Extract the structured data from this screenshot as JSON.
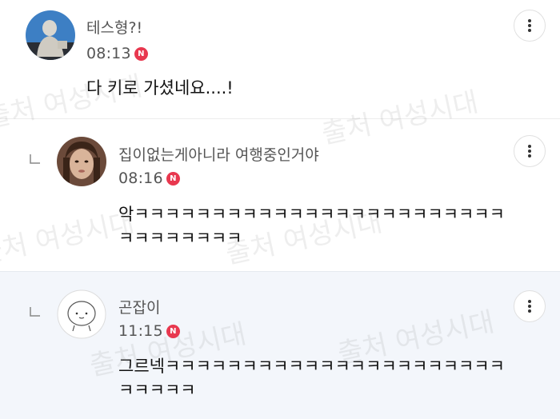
{
  "comments": [
    {
      "username": "테스형?!",
      "time": "08:13",
      "badge": "N",
      "text": "다 키로 가셨네요....!",
      "avatar": "statue-photo",
      "is_reply": false
    },
    {
      "username": "집이없는게아니라 여행중인거야",
      "time": "08:16",
      "badge": "N",
      "text": "악ㅋㅋㅋㅋㅋㅋㅋㅋㅋㅋㅋㅋㅋㅋㅋㅋㅋㅋㅋㅋㅋㅋㅋㅋ\nㅋㅋㅋㅋㅋㅋㅋㅋ",
      "avatar": "woman-photo",
      "is_reply": true
    },
    {
      "username": "곤잡이",
      "time": "11:15",
      "badge": "N",
      "text": "그르넥ㅋㅋㅋㅋㅋㅋㅋㅋㅋㅋㅋㅋㅋㅋㅋㅋㅋㅋㅋㅋㅋㅋ\nㅋㅋㅋㅋㅋ",
      "avatar": "default-face",
      "is_reply": true
    }
  ],
  "watermark": "출처 여성시대",
  "icons": {
    "more": "more-vertical-icon",
    "reply": "reply-indicator-icon",
    "new": "new-badge"
  },
  "colors": {
    "badge": "#e8384f",
    "highlight_bg": "#f3f6fb"
  }
}
